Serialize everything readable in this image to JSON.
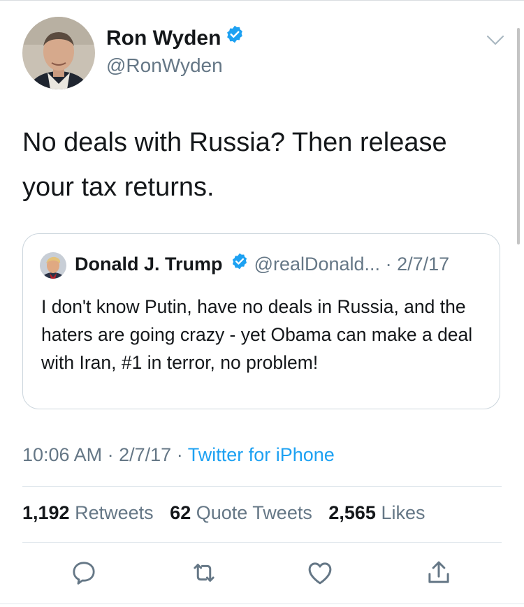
{
  "tweet": {
    "author": {
      "display_name": "Ron Wyden",
      "handle": "@RonWyden",
      "verified": true
    },
    "text": "No deals with Russia? Then release your tax returns.",
    "quoted_tweet": {
      "author": {
        "display_name": "Donald J. Trump",
        "handle": "@realDonald...",
        "verified": true
      },
      "separator": "·",
      "date": "2/7/17",
      "text": "I don't know Putin, have no deals in Russia, and the haters are going crazy - yet Obama can make a deal with Iran, #1 in terror, no problem!"
    },
    "time": "10:06 AM",
    "date": "2/7/17",
    "separator": "·",
    "source": "Twitter for iPhone",
    "stats": {
      "retweets_count": "1,192",
      "retweets_label": "Retweets",
      "quotes_count": "62",
      "quotes_label": "Quote Tweets",
      "likes_count": "2,565",
      "likes_label": "Likes"
    },
    "actions": [
      "reply-icon",
      "retweet-icon",
      "like-icon",
      "share-icon"
    ]
  },
  "colors": {
    "text": "#14171a",
    "secondary_text": "#657786",
    "link": "#1da1f2",
    "verified_badge": "#1da1f2",
    "border": "#ccd6dd"
  }
}
